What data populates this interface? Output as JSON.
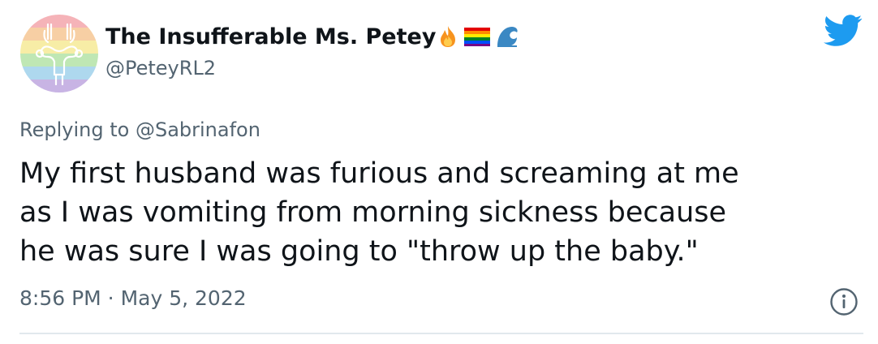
{
  "tweet": {
    "display_name": "The Insufferable Ms. Petey",
    "name_emojis": [
      "fire-emoji",
      "rainbow-flag-emoji",
      "wave-emoji"
    ],
    "handle": "@PeteyRL2",
    "reply_prefix": "Replying to",
    "reply_mention": "@Sabrinafon",
    "text_lines": [
      "My first husband was furious and screaming at me",
      "as I was vomiting from morning sickness because",
      "he was sure I was going to \"throw up the baby.\""
    ],
    "timestamp": "8:56 PM · May 5, 2022"
  },
  "icons": {
    "brand": "twitter-bird-icon",
    "info": "info-icon",
    "avatar": "rainbow-avatar-icon"
  },
  "colors": {
    "twitter_blue": "#1d9bf0",
    "text_primary": "#0f1419",
    "text_secondary": "#536471"
  }
}
